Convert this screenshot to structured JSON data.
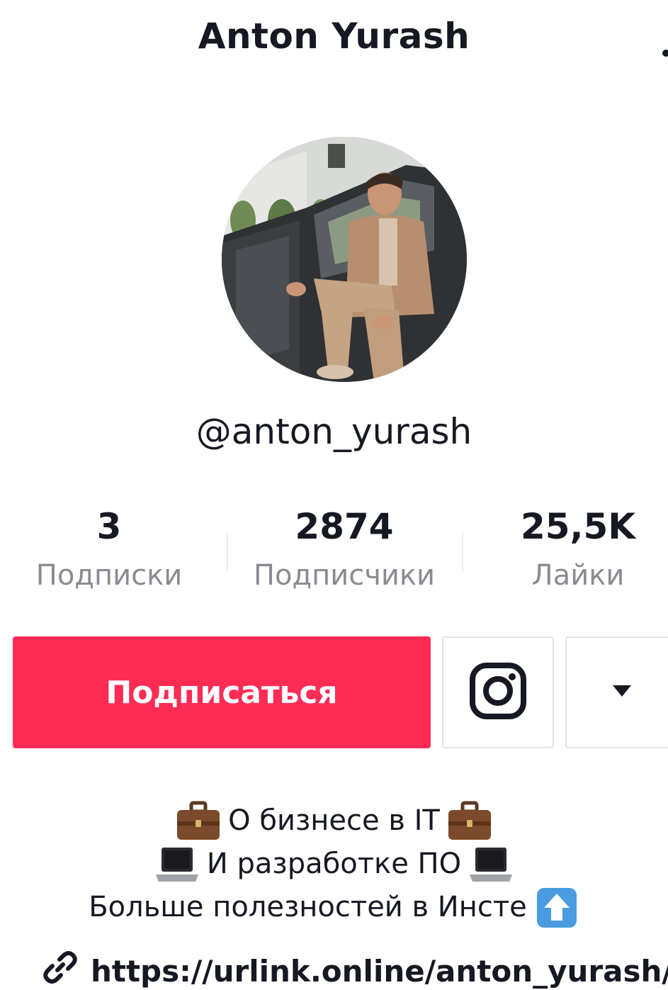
{
  "header": {
    "title": "Anton Yurash"
  },
  "profile": {
    "username": "@anton_yurash"
  },
  "stats": [
    {
      "value": "3",
      "label": "Подписки"
    },
    {
      "value": "2874",
      "label": "Подписчики"
    },
    {
      "value": "25,5K",
      "label": "Лайки"
    }
  ],
  "actions": {
    "follow_label": "Подписаться",
    "instagram_icon": "instagram-icon",
    "dropdown_icon": "caret-down-icon"
  },
  "bio": {
    "line1": "О бизнесе в IT",
    "line2": "И разработке ПО",
    "line3": "Больше полезностей в Инсте",
    "icons": [
      "briefcase-emoji",
      "laptop-emoji",
      "up-arrow-emoji"
    ]
  },
  "link": {
    "icon": "link-icon",
    "url": "https://urlink.online/anton_yurash/"
  },
  "colors": {
    "accent": "#fe2c55",
    "text": "#161823",
    "muted": "#8a8b91"
  }
}
